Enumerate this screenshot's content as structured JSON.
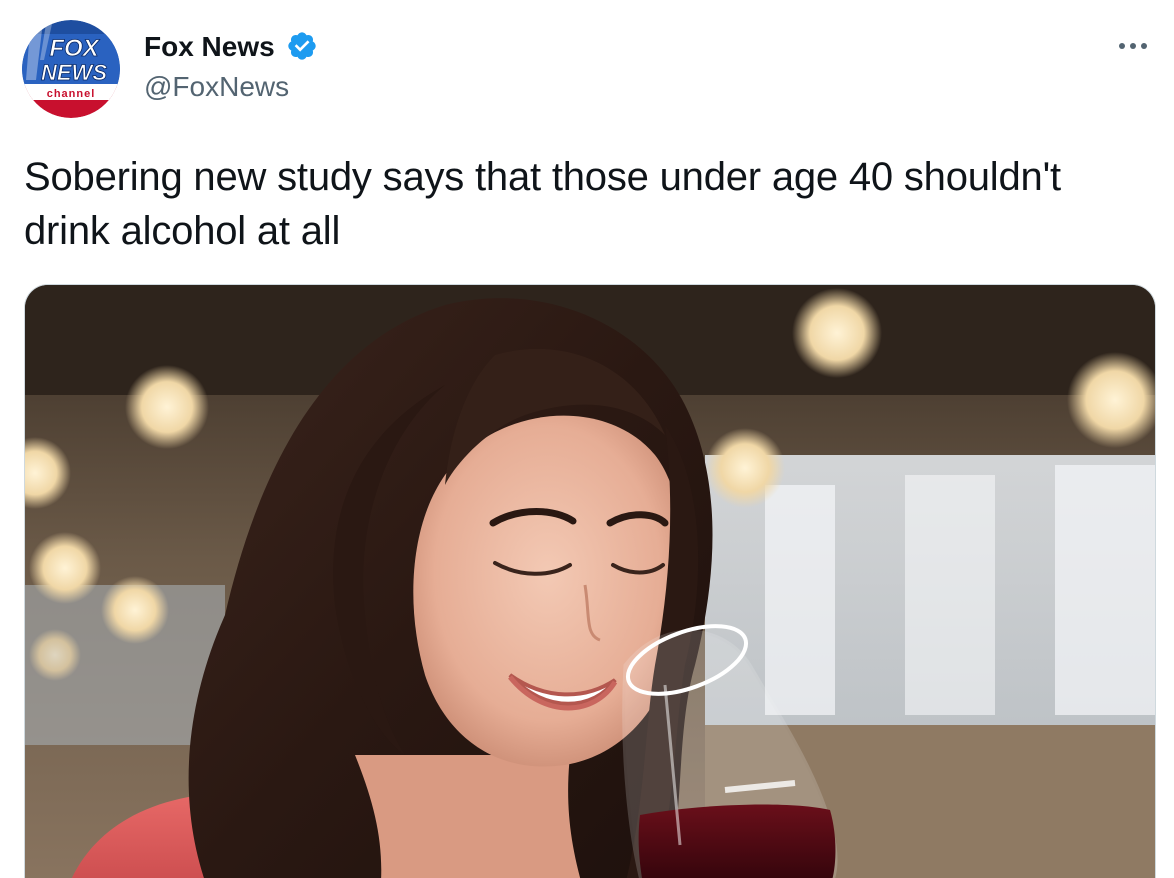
{
  "tweet": {
    "author": {
      "display_name": "Fox News",
      "handle": "@FoxNews",
      "verified": true,
      "avatar": {
        "logo_line1": "FOX",
        "logo_line2": "NEWS",
        "logo_line3": "channel"
      }
    },
    "text": "Sobering new study says that those under age 40 shouldn't drink alcohol at all",
    "more_icon": "more-horizontal-icon",
    "verified_icon": "verified-badge-icon",
    "media": {
      "type": "photo"
    }
  },
  "colors": {
    "text_primary": "#0f1419",
    "text_secondary": "#536471",
    "verified_blue": "#1d9bf0",
    "fox_blue": "#1e4ea0",
    "fox_red": "#c8102e"
  }
}
